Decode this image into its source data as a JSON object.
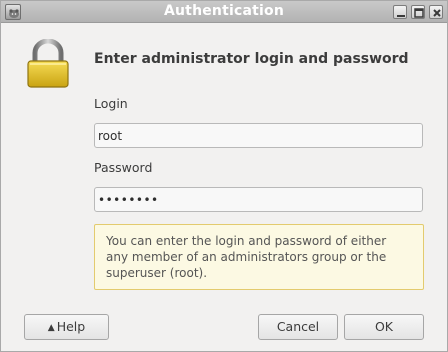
{
  "window": {
    "title": "Authentication",
    "app_icon": "hamster-icon",
    "controls": {
      "minimize": "minimize-icon",
      "maximize": "maximize-icon",
      "close": "close-icon"
    }
  },
  "dialog": {
    "icon": "lock-icon",
    "heading": "Enter administrator login and password",
    "login_label": "Login",
    "login_value": "root",
    "password_label": "Password",
    "password_value": "••••••••",
    "info_text": "You can enter the login and password of either any member of an administrators group or the superuser (root).",
    "colors": {
      "info_background": "#fcf9e3",
      "info_border": "#e3cb6e",
      "lock_gold": "#e8c22a"
    }
  },
  "buttons": {
    "help_icon": "triangle-up-icon",
    "help_label": "Help",
    "cancel_label": "Cancel",
    "ok_label": "OK"
  }
}
